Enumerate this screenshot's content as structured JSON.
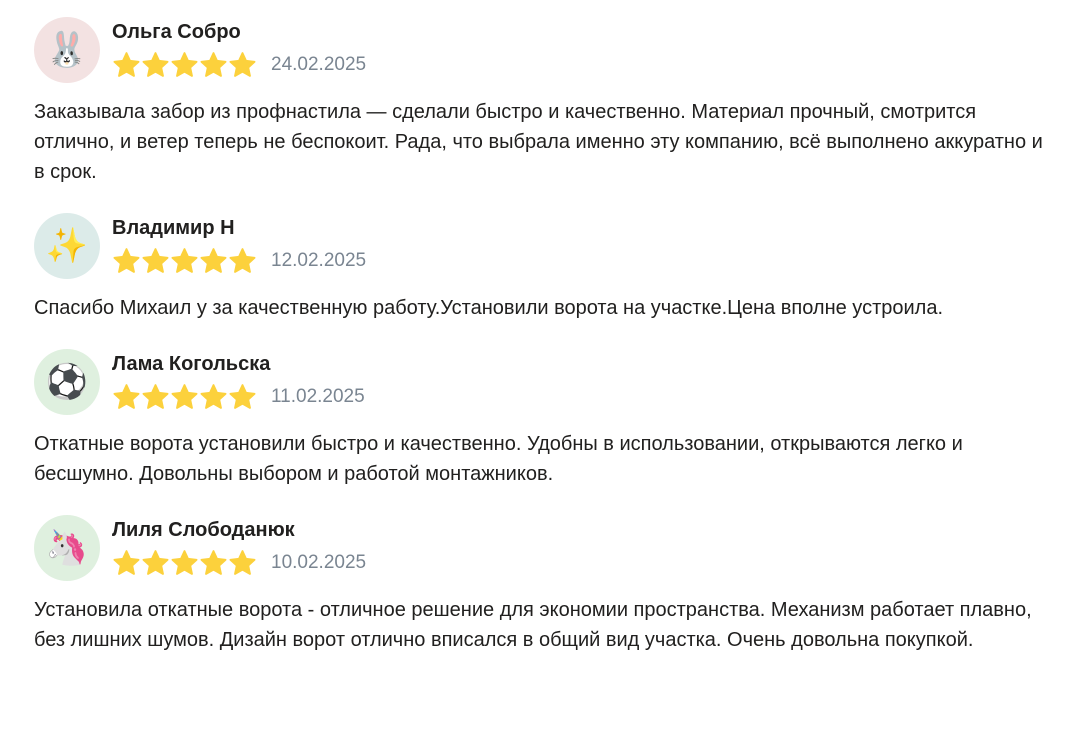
{
  "colors": {
    "star": "#fcd13c",
    "date": "#7a8591",
    "text": "#21201f"
  },
  "reviews": [
    {
      "author": "Ольга Собро",
      "avatar_icon": "bunny-face-icon",
      "avatar_glyph": "🐰",
      "avatar_bg": "#f3e2e2",
      "rating": 5,
      "date": "24.02.2025",
      "text": "Заказывала забор из профнастила — сделали быстро и качественно. Материал прочный, смотрится отлично, и ветер теперь не беспокоит. Рада, что выбрала именно эту компанию, всё выполнено аккуратно и в срок."
    },
    {
      "author": "Владимир Н",
      "avatar_icon": "sparkles-icon",
      "avatar_glyph": "✨",
      "avatar_bg": "#dcebe9",
      "rating": 5,
      "date": "12.02.2025",
      "text": "Спасибо Михаил у за качественную работу.Установили ворота на участке.Цена вполне устроила."
    },
    {
      "author": "Лама Когольска",
      "avatar_icon": "soccer-ball-icon",
      "avatar_glyph": "⚽",
      "avatar_bg": "#dff0df",
      "rating": 5,
      "date": "11.02.2025",
      "text": "Откатные ворота установили быстро и качественно. Удобны в использовании, открываются легко и бесшумно. Довольны выбором и работой монтажников."
    },
    {
      "author": "Лиля Слободанюк",
      "avatar_icon": "unicorn-face-icon",
      "avatar_glyph": "🦄",
      "avatar_bg": "#dff0df",
      "rating": 5,
      "date": "10.02.2025",
      "text": "Установила откатные ворота - отличное решение для экономии пространства. Механизм работает плавно, без лишних шумов. Дизайн ворот отлично вписался в общий вид участка. Очень довольна покупкой."
    }
  ]
}
